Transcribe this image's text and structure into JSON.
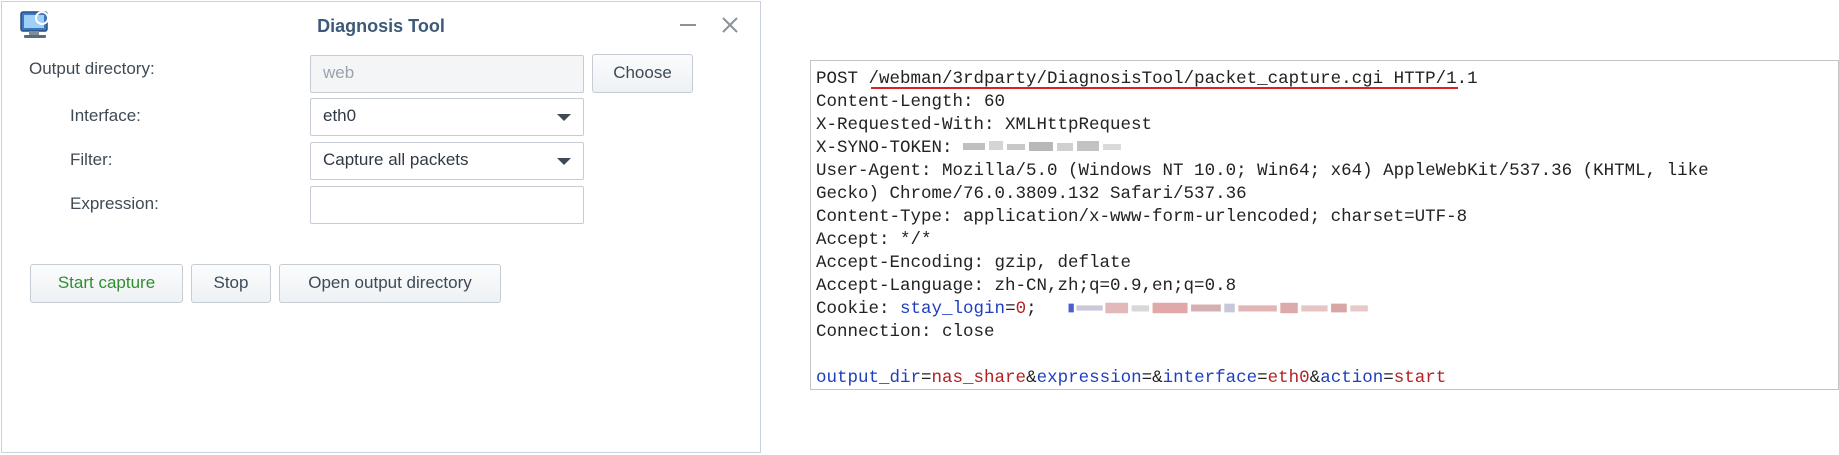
{
  "dialog": {
    "title": "Diagnosis Tool",
    "output_directory_label": "Output directory:",
    "output_directory_value": "web",
    "choose_button": "Choose",
    "interface_label": "Interface:",
    "interface_value": "eth0",
    "filter_label": "Filter:",
    "filter_value": "Capture all packets",
    "expression_label": "Expression:",
    "expression_value": "",
    "start_button": "Start capture",
    "stop_button": "Stop",
    "open_dir_button": "Open output directory"
  },
  "request": {
    "method": "POST",
    "path": "/webman/3rdparty/DiagnosisTool/packet_capture.cgi",
    "protocol": "HTTP/1.1",
    "content_length": "Content-Length: 60",
    "requested_with": "X-Requested-With: XMLHttpRequest",
    "syno_token_label": "X-SYNO-TOKEN:",
    "user_agent_1": "User-Agent: Mozilla/5.0 (Windows NT 10.0; Win64; x64) AppleWebKit/537.36 (KHTML, like",
    "user_agent_2": "Gecko) Chrome/76.0.3809.132 Safari/537.36",
    "content_type": "Content-Type: application/x-www-form-urlencoded; charset=UTF-8",
    "accept": "Accept: */*",
    "accept_encoding": "Accept-Encoding: gzip, deflate",
    "accept_language": "Accept-Language: zh-CN,zh;q=0.9,en;q=0.8",
    "cookie_label": "Cookie:",
    "cookie_key": "stay_login",
    "cookie_eq": "=",
    "cookie_val": "0",
    "cookie_semicolon": ";",
    "connection": "Connection: close",
    "body": {
      "k1": "output_dir",
      "v1": "nas_share",
      "k2": "expression",
      "v2": "",
      "k3": "interface",
      "v3": "eth0",
      "k4": "action",
      "v4": "start",
      "eq": "=",
      "amp": "&"
    }
  },
  "colors": {
    "title": "#3d5a78",
    "key_blue": "#1f3fbf",
    "value_red": "#b22222",
    "underline_red": "#e02020",
    "start_green": "#2f8f2f"
  }
}
